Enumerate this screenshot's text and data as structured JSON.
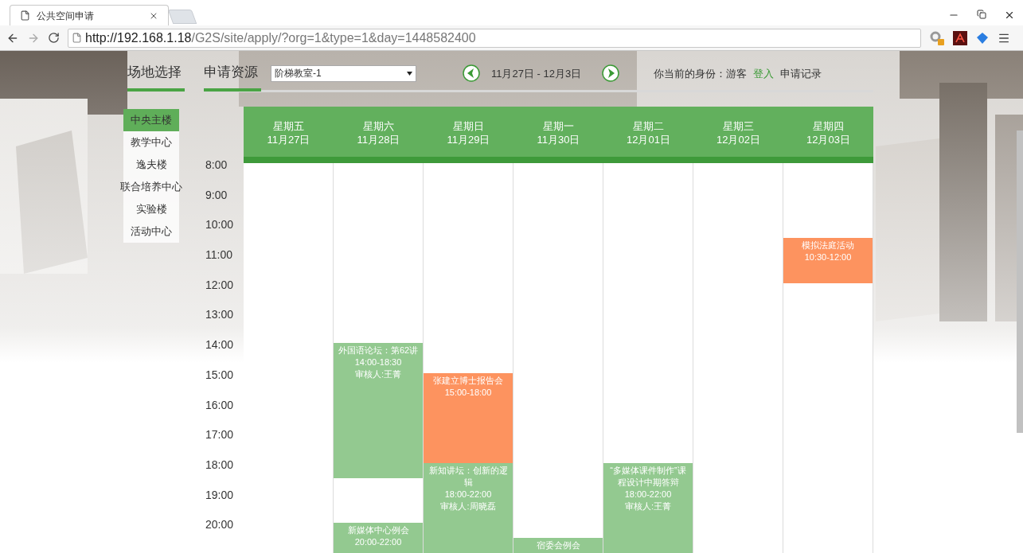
{
  "browser": {
    "tab_title": "公共空间申请",
    "url_host": "http://192.168.1.18",
    "url_path": "/G2S/site/apply/?org=1&type=1&day=1448582400"
  },
  "nav": {
    "tabs": [
      {
        "label": "场地选择",
        "selected": true
      },
      {
        "label": "申请资源",
        "selected": true
      }
    ],
    "resource_select": {
      "value": "阶梯教室-1"
    },
    "date_range": "11月27日 - 12月3日",
    "identity": "你当前的身份：游客",
    "login": "登入",
    "records": "申请记录"
  },
  "buildings": [
    {
      "label": "中央主楼",
      "selected": true
    },
    {
      "label": "教学中心",
      "selected": false
    },
    {
      "label": "逸夫楼",
      "selected": false
    },
    {
      "label": "联合培养中心",
      "selected": false
    },
    {
      "label": "实验楼",
      "selected": false
    },
    {
      "label": "活动中心",
      "selected": false
    }
  ],
  "hours": [
    "8:00",
    "9:00",
    "10:00",
    "11:00",
    "12:00",
    "13:00",
    "14:00",
    "15:00",
    "16:00",
    "17:00",
    "18:00",
    "19:00",
    "20:00"
  ],
  "days": [
    {
      "weekday": "星期五",
      "date": "11月27日"
    },
    {
      "weekday": "星期六",
      "date": "11月28日",
      "events": [
        {
          "name": "外国语论坛：第62讲",
          "time": "14:00-18:30",
          "reviewer": "审核人:王菁",
          "color": "#93c990"
        },
        {
          "name": "新媒体中心例会",
          "time": "20:00-22:00",
          "color": "#93c990"
        }
      ]
    },
    {
      "weekday": "星期日",
      "date": "11月29日",
      "events": [
        {
          "name": "张建立博士报告会",
          "time": "15:00-18:00",
          "color": "#fd935f"
        },
        {
          "name": "新知讲坛：创新的逻辑",
          "time": "18:00-22:00",
          "reviewer": "审核人:周晓磊",
          "color": "#93c990"
        }
      ]
    },
    {
      "weekday": "星期一",
      "date": "11月30日",
      "events": [
        {
          "name": "宿委会例会",
          "color": "#93c990"
        }
      ]
    },
    {
      "weekday": "星期二",
      "date": "12月01日",
      "events": [
        {
          "name": "“多媒体课件制作”课程设计中期答辩",
          "time": "18:00-22:00",
          "reviewer": "审核人:王菁",
          "color": "#93c990"
        }
      ]
    },
    {
      "weekday": "星期三",
      "date": "12月02日"
    },
    {
      "weekday": "星期四",
      "date": "12月03日",
      "events": [
        {
          "name": "模拟法庭活动",
          "time": "10:30-12:00",
          "color": "#fd935f"
        }
      ]
    }
  ]
}
